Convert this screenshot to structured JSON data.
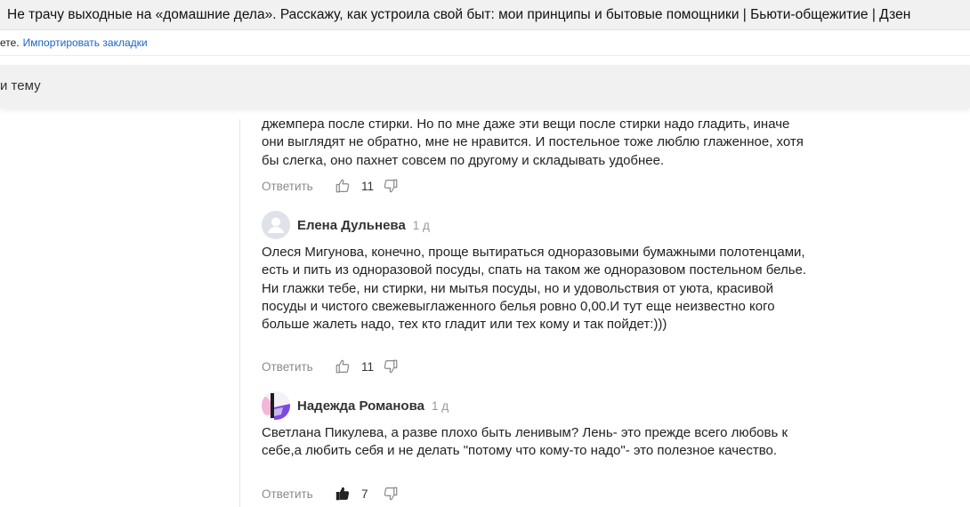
{
  "window": {
    "title": "Не трачу выходные на «домашние дела». Расскажу, как устроила свой быт: мои принципы и бытовые помощники | Бьюти-общежитие | Дзен"
  },
  "bookmarks_bar": {
    "text": "ете.",
    "import_link": "Импортировать закладки"
  },
  "topic_bar": {
    "label": "и тему"
  },
  "comments": [
    {
      "text": "джемпера после стирки. Но по мне даже эти вещи после стирки надо гладить, иначе они выглядят не обратно, мне не нравится. И постельное тоже люблю глаженное, хотя бы слегка, оно пахнет совсем по другому и складывать удобнее.",
      "reply_label": "Ответить",
      "likes": "11",
      "liked": false
    },
    {
      "author": "Елена Дульнева",
      "time": "1 д",
      "avatar_icon": "default-user-avatar-icon",
      "text": "Олеся Мигунова, конечно, проще вытираться одноразовыми бумажными полотенцами, есть и пить из одноразовой посуды, спать на таком же одноразовом постельном белье. Ни глажки тебе, ни стирки, ни мытья посуды, но и удовольствия от уюта, красивой посуды и чистого свежевыглаженного белья ровно 0,00.И тут еще неизвестно кого больше жалеть надо, тех кто гладит или тех кому и так пойдет:)))",
      "reply_label": "Ответить",
      "likes": "11",
      "liked": false
    },
    {
      "author": "Надежда Романова",
      "time": "1 д",
      "avatar_icon": "abstract-photo-avatar-icon",
      "text": "Светлана Пикулева, а разве плохо быть ленивым? Лень- это прежде всего любовь к себе,а любить себя и не делать \"потому что кому-то надо\"- это полезное качество.",
      "reply_label": "Ответить",
      "likes": "7",
      "liked": true
    }
  ],
  "colors": {
    "link": "#1a63c7",
    "muted": "#8a8a8a",
    "tab_bar": "#f1f1f1"
  }
}
